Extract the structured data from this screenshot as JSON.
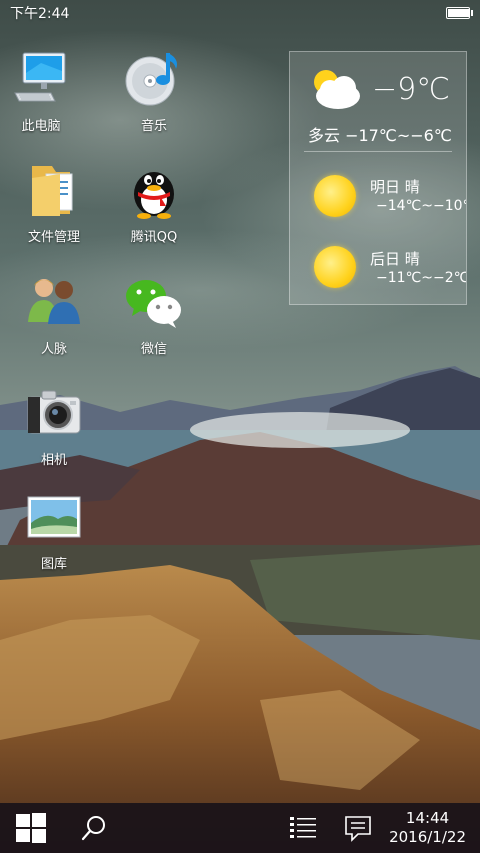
{
  "status_bar": {
    "time": "下午2:44",
    "battery_level": 1.0
  },
  "apps": [
    {
      "label": "此电脑",
      "icon": "computer-icon"
    },
    {
      "label": "音乐",
      "icon": "music-icon"
    },
    {
      "label": "文件管理",
      "icon": "folder-icon"
    },
    {
      "label": "腾讯QQ",
      "icon": "qq-penguin-icon"
    },
    {
      "label": "人脉",
      "icon": "contacts-icon"
    },
    {
      "label": "微信",
      "icon": "wechat-icon"
    },
    {
      "label": "相机",
      "icon": "camera-icon"
    },
    {
      "label": "图库",
      "icon": "gallery-icon"
    }
  ],
  "weather": {
    "current_temp": "−9℃",
    "current_desc": "多云 −17℃~−6℃",
    "forecast": [
      {
        "day": "明日 晴",
        "range": "−14℃~−10℃"
      },
      {
        "day": "后日 晴",
        "range": "−11℃~−2℃"
      }
    ]
  },
  "taskbar": {
    "time": "14:44",
    "date": "2016/1/22",
    "icons": [
      "windows-start-icon",
      "search-icon",
      "task-list-icon",
      "notification-icon"
    ]
  }
}
